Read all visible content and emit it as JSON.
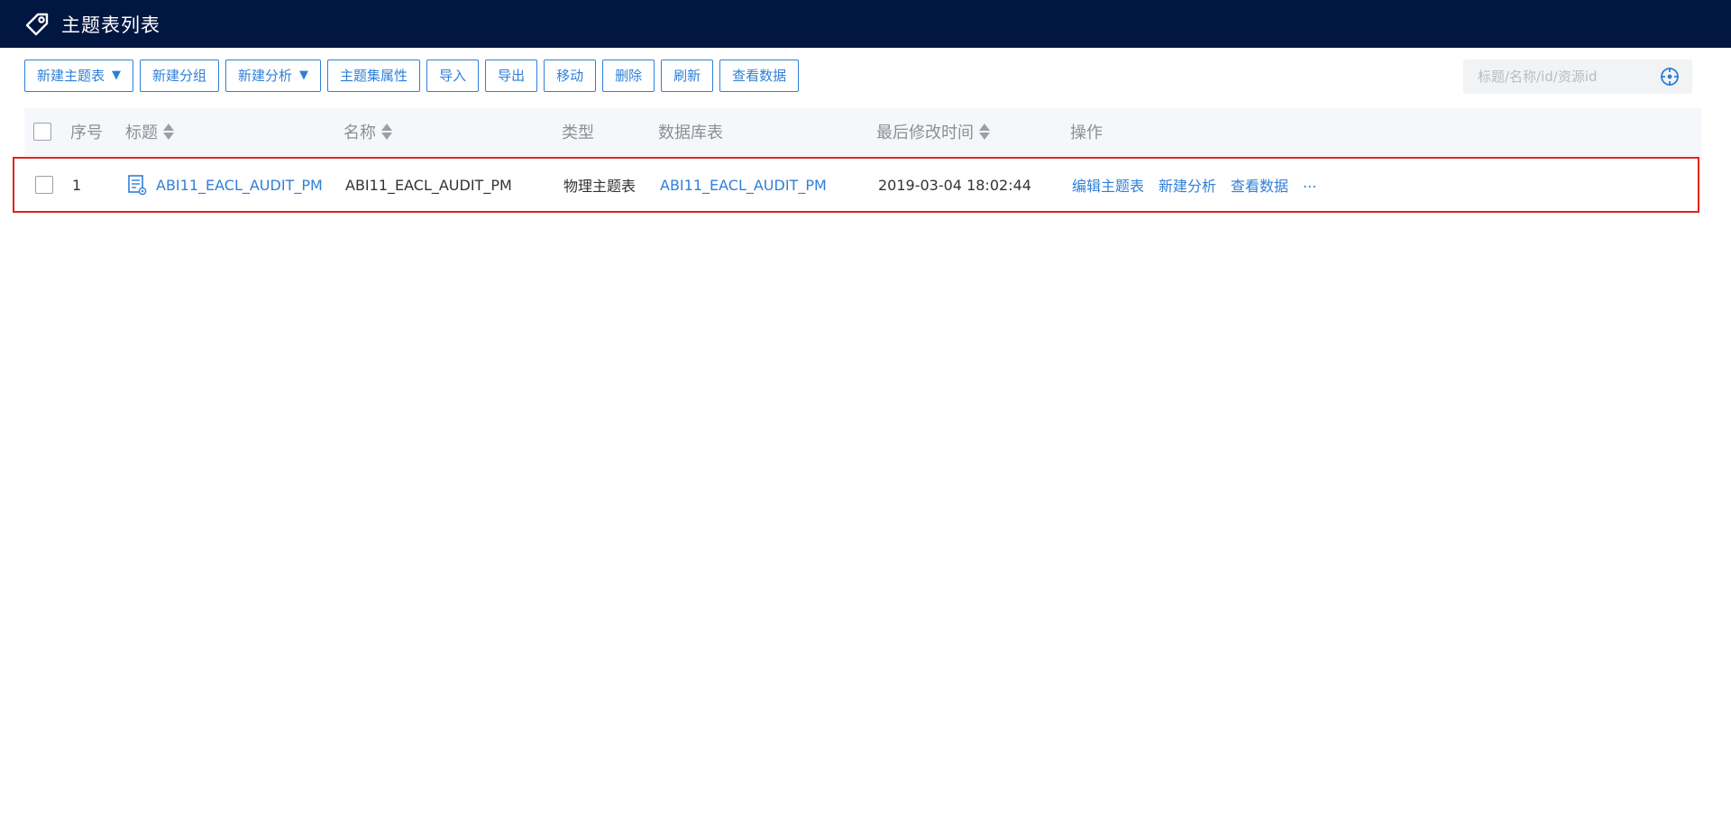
{
  "header": {
    "title": "主题表列表",
    "icon": "tag-icon"
  },
  "toolbar": {
    "buttons": [
      {
        "label": "新建主题表",
        "dropdown": true
      },
      {
        "label": "新建分组",
        "dropdown": false
      },
      {
        "label": "新建分析",
        "dropdown": true
      },
      {
        "label": "主题集属性",
        "dropdown": false
      },
      {
        "label": "导入",
        "dropdown": false
      },
      {
        "label": "导出",
        "dropdown": false
      },
      {
        "label": "移动",
        "dropdown": false
      },
      {
        "label": "删除",
        "dropdown": false
      },
      {
        "label": "刷新",
        "dropdown": false
      },
      {
        "label": "查看数据",
        "dropdown": false
      }
    ],
    "caret": "▼"
  },
  "search": {
    "placeholder": "标题/名称/id/资源id",
    "value": "",
    "icon": "target-icon"
  },
  "table": {
    "columns": {
      "index": "序号",
      "title": "标题",
      "name": "名称",
      "type": "类型",
      "db_table": "数据库表",
      "modified": "最后修改时间",
      "ops": "操作"
    },
    "rows": [
      {
        "index": "1",
        "title": "ABI11_EACL_AUDIT_PM",
        "name": "ABI11_EACL_AUDIT_PM",
        "type": "物理主题表",
        "db_table": "ABI11_EACL_AUDIT_PM",
        "modified": "2019-03-04 18:02:44",
        "ops": [
          "编辑主题表",
          "新建分析",
          "查看数据",
          "..."
        ]
      }
    ]
  },
  "colors": {
    "header_bg": "#011640",
    "accent": "#2f7fd8",
    "highlight_border": "#e0231c"
  }
}
